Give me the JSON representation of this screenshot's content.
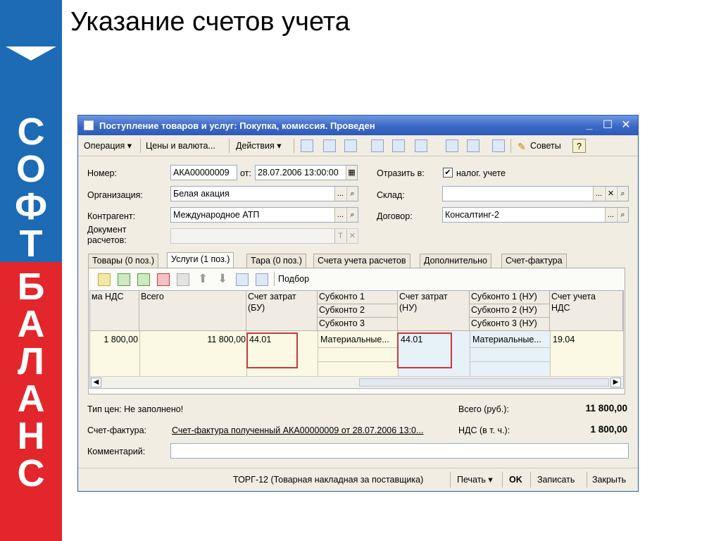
{
  "slide": {
    "title": "Указание счетов учета",
    "brand_top": [
      "С",
      "О",
      "Ф",
      "Т"
    ],
    "brand_bottom": [
      "Б",
      "А",
      "Л",
      "А",
      "Н",
      "С"
    ]
  },
  "window": {
    "title": "Поступление товаров и услуг: Покупка, комиссия. Проведен",
    "toolbar": {
      "operation": "Операция ▾",
      "prices": "Цены и валюта...",
      "actions": "Действия ▾",
      "tips": "Советы",
      "help": "?"
    },
    "header": {
      "number_label": "Номер:",
      "number_value": "АКА00000009",
      "date_label": "от:",
      "date_value": "28.07.2006 13:00:00",
      "reflect_label": "Отразить в:",
      "tax_checkbox_label": "налог. учете",
      "org_label": "Организация:",
      "org_value": "Белая акация",
      "warehouse_label": "Склад:",
      "warehouse_value": "",
      "counterparty_label": "Контрагент:",
      "counterparty_value": "Международное АТП",
      "contract_label": "Договор:",
      "contract_value": "Консалтинг-2",
      "settlement_doc_label_1": "Документ",
      "settlement_doc_label_2": "расчетов:",
      "settlement_doc_value": ""
    },
    "tabs": [
      "Товары (0 поз.)",
      "Услуги (1 поз.)",
      "Тара (0 поз.)",
      "Счета учета расчетов",
      "Дополнительно",
      "Счет-фактура"
    ],
    "table_toolbar": {
      "pick": "Подбор"
    },
    "table": {
      "headers": {
        "vat": "ма НДС",
        "total": "Всего",
        "cost_bu_1": "Счет затрат",
        "cost_bu_2": "(БУ)",
        "sub1": "Субконто 1",
        "sub2": "Субконто 2",
        "sub3": "Субконто 3",
        "cost_nu_1": "Счет затрат",
        "cost_nu_2": "(НУ)",
        "sub1nu": "Субконто 1 (НУ)",
        "sub2nu": "Субконто 2 (НУ)",
        "sub3nu": "Субконто 3 (НУ)",
        "acc_1": "Счет учета",
        "acc_2": "НДС"
      },
      "row": {
        "vat": "1 800,00",
        "total": "11 800,00",
        "cost_bu": "44.01",
        "sub1": "Материальные...",
        "cost_nu": "44.01",
        "sub1nu": "Материальные...",
        "acc": "19.04"
      }
    },
    "summary": {
      "price_type": "Тип цен: Не заполнено!",
      "total_label": "Всего (руб.):",
      "total_value": "11 800,00",
      "invoice_label": "Счет-фактура:",
      "invoice_link": "Счет-фактура полученный АКА00000009 от 28.07.2006 13:0...",
      "vat_label": "НДС (в т. ч.):",
      "vat_value": "1 800,00",
      "comment_label": "Комментарий:",
      "comment_value": ""
    },
    "footer": {
      "torg": "ТОРГ-12 (Товарная накладная за поставщика)",
      "print": "Печать ▾",
      "ok": "OK",
      "save": "Записать",
      "close": "Закрыть"
    }
  },
  "colors": {
    "sidebar_blue": "#1c6bb4",
    "sidebar_red": "#e3262b",
    "highlight": "#c43b3b"
  }
}
